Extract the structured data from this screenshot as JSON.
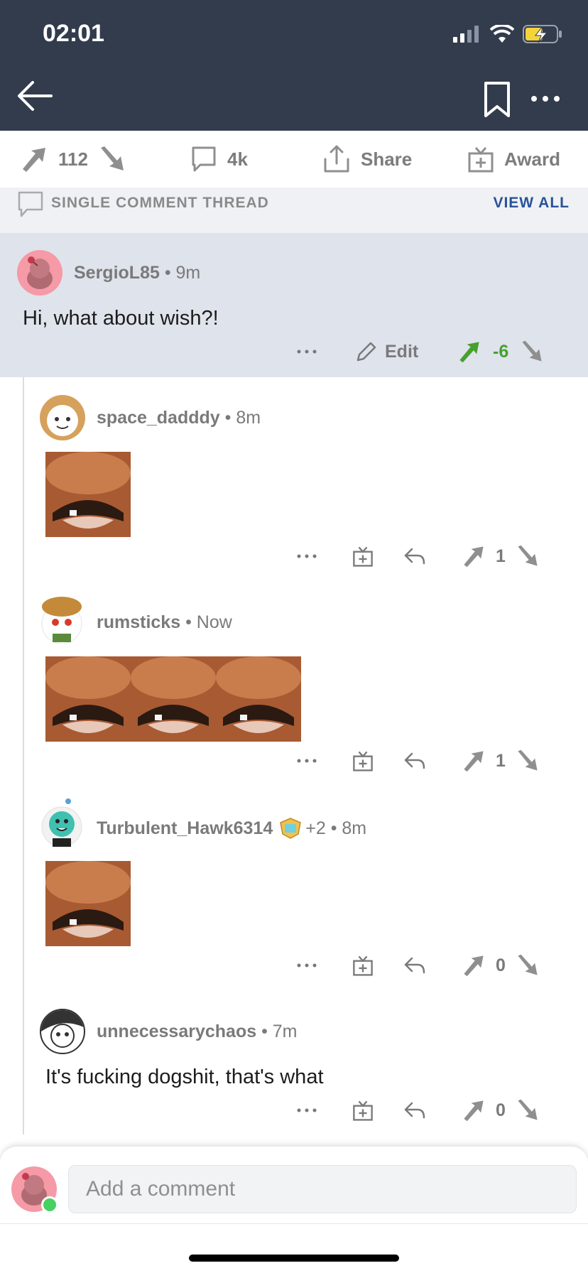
{
  "status": {
    "time": "02:01"
  },
  "post_actions": {
    "upvotes": "112",
    "comments": "4k",
    "share_label": "Share",
    "award_label": "Award"
  },
  "thread": {
    "label": "SINGLE COMMENT THREAD",
    "view_all": "VIEW ALL"
  },
  "op_comment": {
    "username": "SergioL85",
    "time": "9m",
    "body": "Hi, what about wish?!",
    "edit_label": "Edit",
    "score": "-6"
  },
  "replies": [
    {
      "username": "space_dadddy",
      "time": "8m",
      "images": 1,
      "score": "1"
    },
    {
      "username": "rumsticks",
      "time": "Now",
      "images": 3,
      "score": "1"
    },
    {
      "username": "Turbulent_Hawk6314",
      "award_count": "+2",
      "time": "8m",
      "images": 1,
      "score": "0"
    },
    {
      "username": "unnecessarychaos",
      "time": "7m",
      "body": "It's fucking dogshit, that's what",
      "score": "0"
    }
  ],
  "composer": {
    "placeholder": "Add a comment"
  },
  "colors": {
    "header": "#323c4c",
    "upvote_active": "#46a02e",
    "link": "#2a5298",
    "op_bg": "#dfe3ec"
  }
}
